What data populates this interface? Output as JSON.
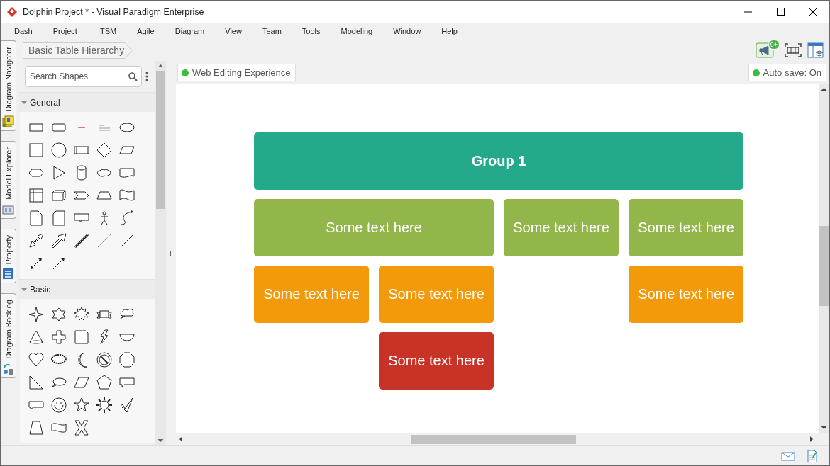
{
  "window": {
    "title": "Dolphin Project * - Visual Paradigm Enterprise"
  },
  "menu": [
    "Dash",
    "Project",
    "ITSM",
    "Agile",
    "Diagram",
    "View",
    "Team",
    "Tools",
    "Modeling",
    "Window",
    "Help"
  ],
  "side_tabs": [
    {
      "label": "Diagram Navigator"
    },
    {
      "label": "Model Explorer"
    },
    {
      "label": "Property"
    },
    {
      "label": "Diagram Backlog"
    }
  ],
  "breadcrumb": "Basic Table Hierarchy",
  "notification_badge": "9+",
  "shape_panel": {
    "search": {
      "placeholder": "Search Shapes"
    },
    "groups": [
      {
        "title": "General",
        "expanded": true
      },
      {
        "title": "Basic",
        "expanded": true
      }
    ]
  },
  "canvas": {
    "badge": "Web Editing Experience",
    "autosave": "Auto save: On",
    "nodes": [
      {
        "text": "Group 1",
        "kind": "group",
        "color": "#24a98b"
      },
      {
        "text": "Some text here",
        "kind": "item",
        "color": "#93b64b"
      },
      {
        "text": "Some text here",
        "kind": "item",
        "color": "#93b64b"
      },
      {
        "text": "Some text here",
        "kind": "item",
        "color": "#93b64b"
      },
      {
        "text": "Some text here",
        "kind": "item",
        "color": "#f39a0b"
      },
      {
        "text": "Some text here",
        "kind": "item",
        "color": "#f39a0b"
      },
      {
        "text": "Some text here",
        "kind": "item",
        "color": "#f39a0b"
      },
      {
        "text": "Some text here",
        "kind": "item",
        "color": "#c83328"
      }
    ]
  }
}
